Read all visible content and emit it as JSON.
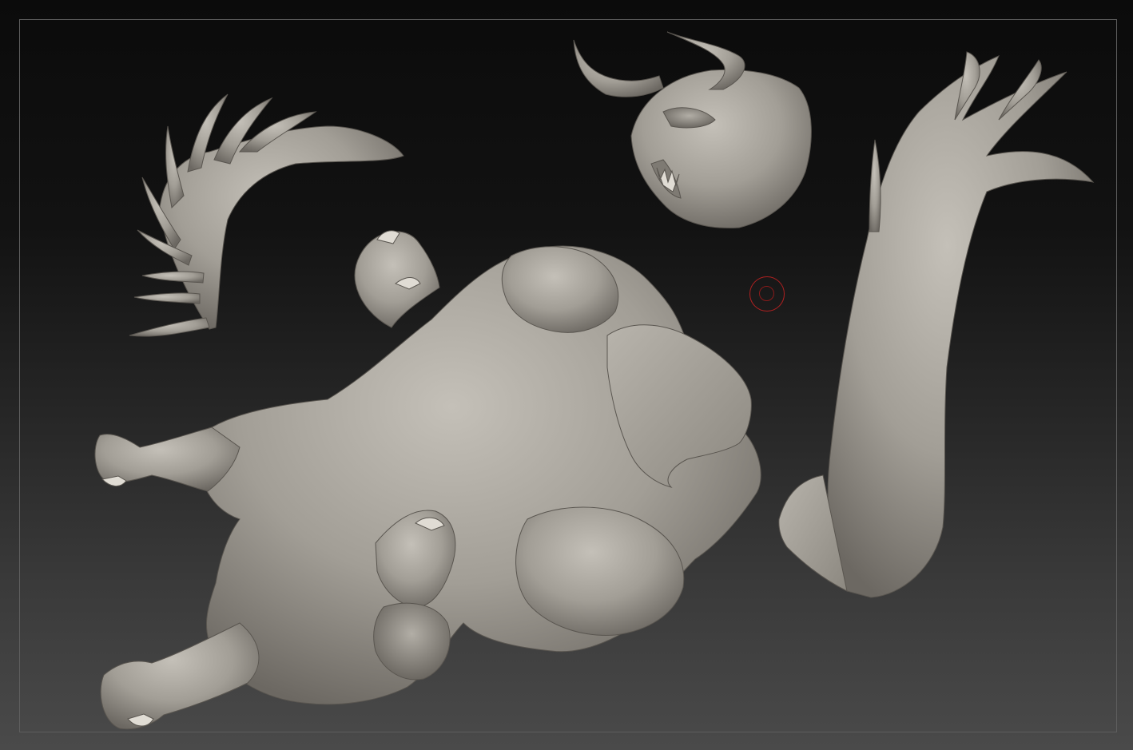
{
  "viewport": {
    "background_top": "#0b0b0b",
    "background_bottom": "#4a4a4a",
    "frame_color": "#5e5e5e",
    "clay_color": "#a8a49c",
    "clay_shadow": "#6f6b64"
  },
  "scene_parts": [
    {
      "name": "left-wing-mesh",
      "kind": "sculpt"
    },
    {
      "name": "demon-head-mesh",
      "kind": "sculpt"
    },
    {
      "name": "right-wing-mesh",
      "kind": "sculpt"
    },
    {
      "name": "demon-body-mesh",
      "kind": "sculpt"
    }
  ],
  "cursor": {
    "icon": "brush-cursor-icon",
    "color": "#b02020"
  }
}
